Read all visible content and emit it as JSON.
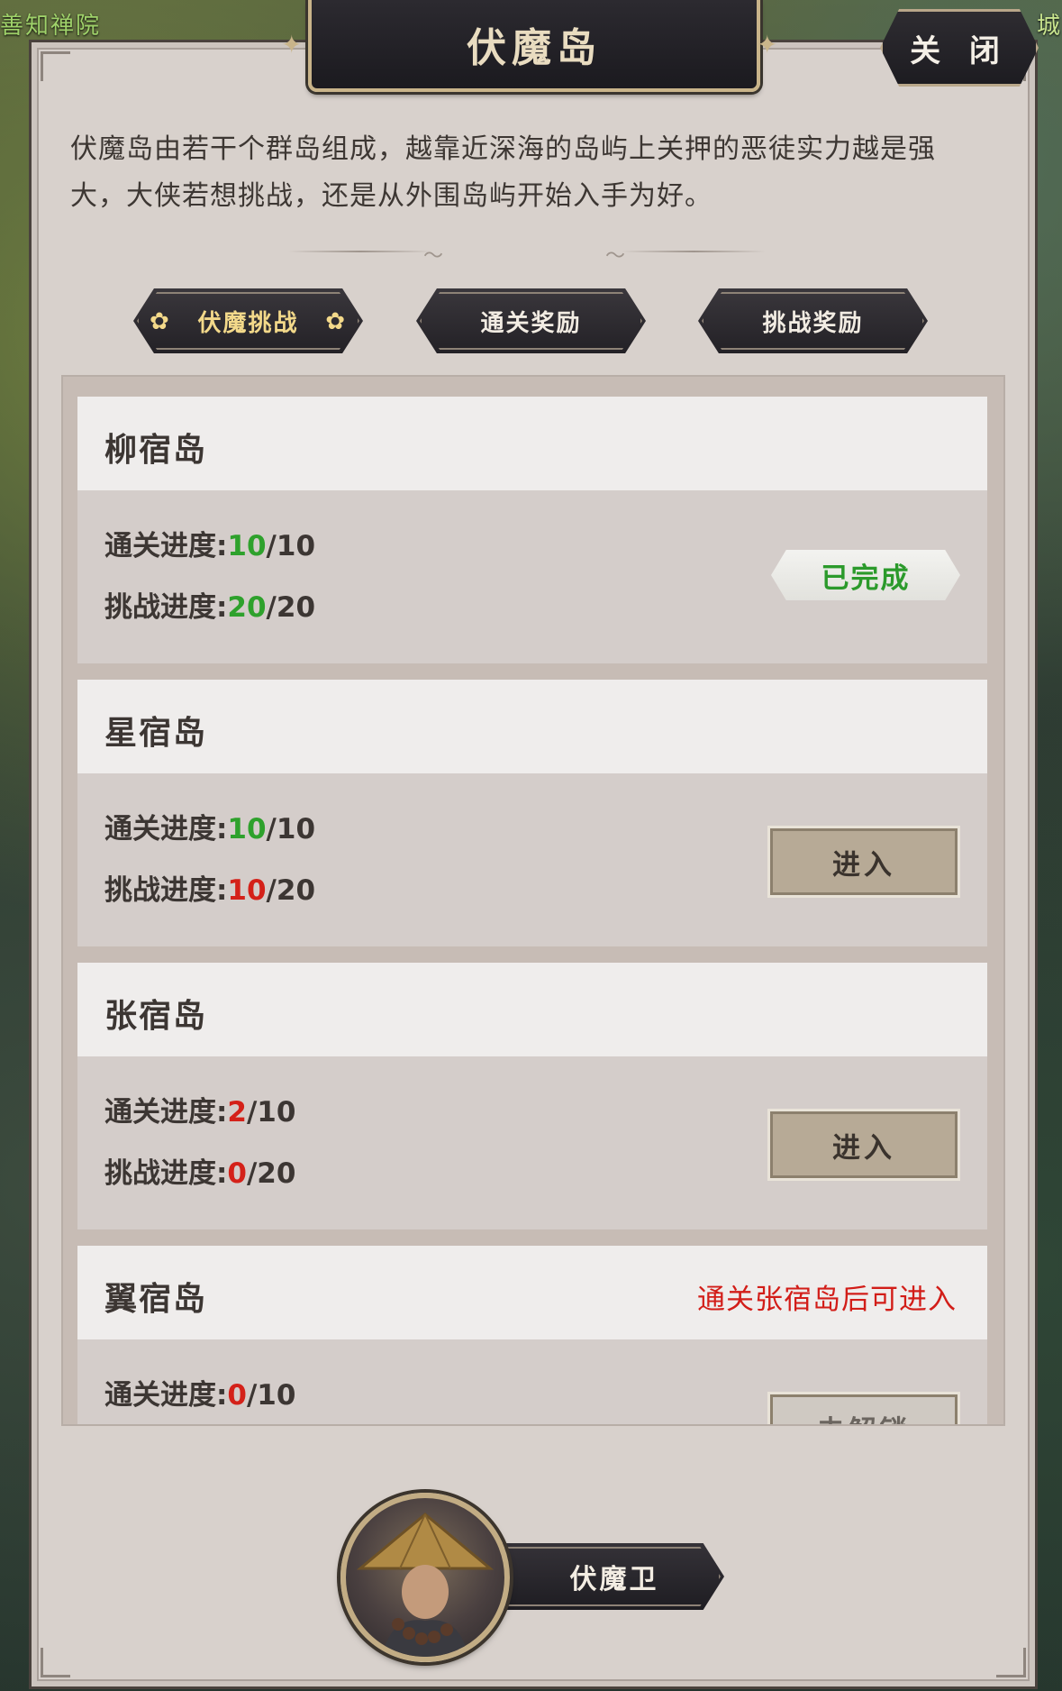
{
  "map": {
    "label_left": "善知禅院",
    "label_right": "城"
  },
  "window": {
    "title": "伏魔岛",
    "close_label": "关 闭",
    "description": "伏魔岛由若干个群岛组成，越靠近深海的岛屿上关押的恶徒实力越是强大，大侠若想挑战，还是从外围岛屿开始入手为好。"
  },
  "tabs": [
    {
      "label": "伏魔挑战",
      "active": true
    },
    {
      "label": "通关奖励",
      "active": false
    },
    {
      "label": "挑战奖励",
      "active": false
    }
  ],
  "progress_labels": {
    "clear": "通关进度:",
    "challenge": "挑战进度:"
  },
  "islands": [
    {
      "name": "柳宿岛",
      "clear_done": "10",
      "clear_total": "/10",
      "challenge_done": "20",
      "challenge_total": "/20",
      "status": "已完成"
    },
    {
      "name": "星宿岛",
      "clear_done": "10",
      "clear_total": "/10",
      "challenge_done": "10",
      "challenge_total": "/20",
      "button": "进入"
    },
    {
      "name": "张宿岛",
      "clear_done": "2",
      "clear_total": "/10",
      "challenge_done": "0",
      "challenge_total": "/20",
      "button": "进入"
    },
    {
      "name": "翼宿岛",
      "hint": "通关张宿岛后可进入",
      "clear_done": "0",
      "clear_total": "/10",
      "button": "未解锁"
    }
  ],
  "guard": {
    "name": "伏魔卫"
  },
  "colors": {
    "complete": "#2ea12c",
    "incomplete": "#d42119",
    "panel": "#d8d1cc",
    "accent_gold": "#c9b48a"
  }
}
